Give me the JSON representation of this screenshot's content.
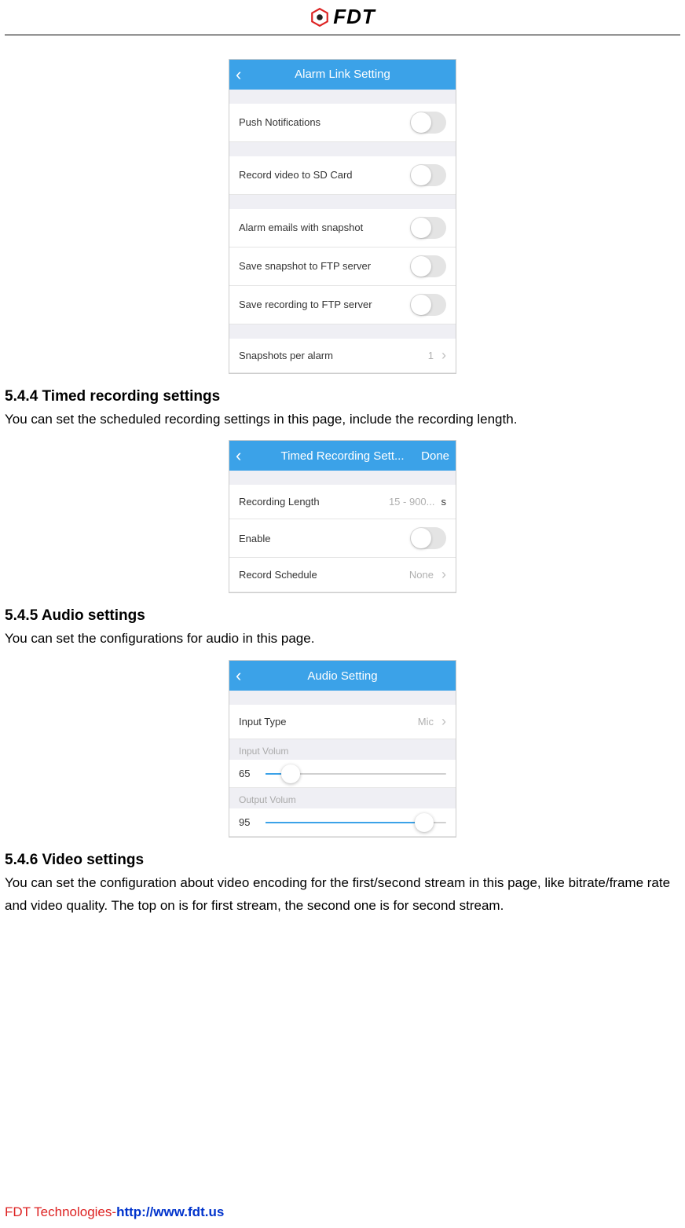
{
  "header": {
    "brand": "FDT"
  },
  "shot_alarm": {
    "title": "Alarm Link Setting",
    "rows": {
      "push": "Push Notifications",
      "record_sd": "Record video to SD Card",
      "alarm_email": "Alarm emails with snapshot",
      "ftp_snap": "Save snapshot to FTP server",
      "ftp_rec": "Save recording to FTP server",
      "snaps_per_alarm_label": "Snapshots per alarm",
      "snaps_per_alarm_value": "1"
    }
  },
  "s544": {
    "heading": "5.4.4 Timed recording settings",
    "text": "You can set the scheduled recording settings in this page, include the recording length."
  },
  "shot_timed": {
    "title": "Timed Recording Sett...",
    "done": "Done",
    "rec_len_label": "Recording Length",
    "rec_len_placeholder": "15 - 900...",
    "rec_len_unit": "s",
    "enable_label": "Enable",
    "sched_label": "Record Schedule",
    "sched_value": "None"
  },
  "s545": {
    "heading": "5.4.5 Audio settings",
    "text": "You can set the configurations for audio in this page."
  },
  "shot_audio": {
    "title": "Audio Setting",
    "input_type_label": "Input Type",
    "input_type_value": "Mic",
    "input_vol_section": "Input Volum",
    "input_vol_value": "65",
    "output_vol_section": "Output Volum",
    "output_vol_value": "95"
  },
  "s546": {
    "heading": "5.4.6 Video settings",
    "text": "You can set the configuration about video encoding for the first/second stream in this page, like bitrate/frame rate and video quality. The top on is for first stream, the second one is for second stream."
  },
  "footer": {
    "company": "FDT Technologies-",
    "url": "http://www.fdt.us"
  }
}
